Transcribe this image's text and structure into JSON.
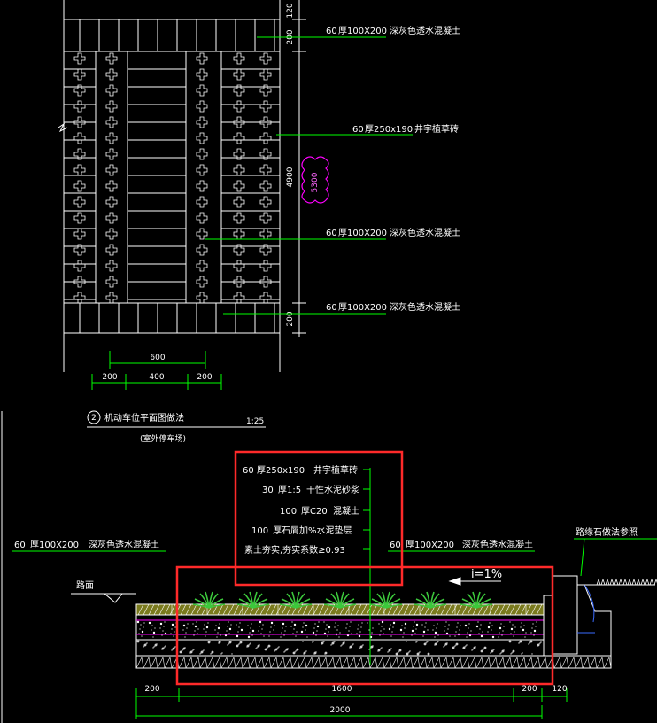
{
  "colors": {
    "background": "#000000",
    "line_white": "#ffffff",
    "line_green": "#00ff00",
    "line_magenta": "#ff00ff",
    "highlight_red": "#ff2a2a",
    "plant_green": "#3cc83c",
    "blue": "#3a6bff"
  },
  "plan": {
    "callouts": [
      {
        "thickness": "60",
        "spec": "厚100X200",
        "material": "深灰色透水混凝土"
      },
      {
        "thickness": "60",
        "spec": "厚250x190",
        "material": "井字植草砖"
      },
      {
        "thickness": "60",
        "spec": "厚100X200",
        "material": "深灰色透水混凝土"
      },
      {
        "thickness": "60",
        "spec": "厚100X200",
        "material": "深灰色透水混凝土"
      }
    ],
    "dims_right": [
      "120",
      "200",
      "4900",
      "200"
    ],
    "cloud_text": "5300",
    "dim_600": "600",
    "dims_bottom": [
      "200",
      "400",
      "200"
    ],
    "title_number": "2",
    "title": "机动车位平面图做法",
    "scale": "1:25",
    "subtitle": "(室外停车场)"
  },
  "section": {
    "layers": [
      {
        "thickness": "60",
        "spec": "厚250x190",
        "material": "井字植草砖"
      },
      {
        "thickness": "30",
        "spec": "厚1:5",
        "material": "干性水泥砂浆"
      },
      {
        "thickness": "100",
        "spec": "厚C20",
        "material": "混凝土"
      },
      {
        "thickness": "100",
        "spec": "厚石屑加%水泥垫层",
        "material": ""
      },
      {
        "thickness": "",
        "spec": "素土夯实,夯实系数≥0.93",
        "material": ""
      }
    ],
    "left_label": {
      "thickness": "60",
      "spec": "厚100X200",
      "material": "深灰色透水混凝土"
    },
    "right_label": {
      "thickness": "60",
      "spec": "厚100X200",
      "material": "深灰色透水混凝土"
    },
    "slope": "i=1%",
    "road_label": "路面",
    "curb_note": "路缘石做法参照",
    "dims_bottom": [
      "200",
      "1600",
      "200",
      "120"
    ],
    "dim_total": "2000"
  }
}
